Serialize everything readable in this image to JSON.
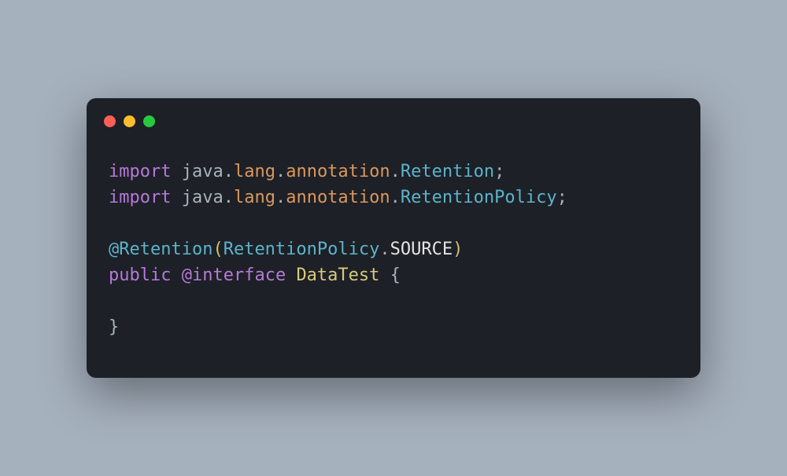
{
  "colors": {
    "background": "#a6b1be",
    "window": "#1d2026",
    "red": "#ff5f56",
    "yellow": "#ffbd2e",
    "green": "#27c93f",
    "keyword": "#b679d9",
    "namespace": "#a8b2bf",
    "package": "#d9985f",
    "type": "#5cb3cc",
    "classname": "#d9c97c",
    "paren": "#d3c173"
  },
  "code": {
    "lines": [
      [
        {
          "t": "import",
          "c": "keyword"
        },
        {
          "t": " ",
          "c": "white"
        },
        {
          "t": "java",
          "c": "namespace"
        },
        {
          "t": ".",
          "c": "op"
        },
        {
          "t": "lang",
          "c": "package"
        },
        {
          "t": ".",
          "c": "op"
        },
        {
          "t": "annotation",
          "c": "package"
        },
        {
          "t": ".",
          "c": "op"
        },
        {
          "t": "Retention",
          "c": "type"
        },
        {
          "t": ";",
          "c": "punct"
        }
      ],
      [
        {
          "t": "import",
          "c": "keyword"
        },
        {
          "t": " ",
          "c": "white"
        },
        {
          "t": "java",
          "c": "namespace"
        },
        {
          "t": ".",
          "c": "op"
        },
        {
          "t": "lang",
          "c": "package"
        },
        {
          "t": ".",
          "c": "op"
        },
        {
          "t": "annotation",
          "c": "package"
        },
        {
          "t": ".",
          "c": "op"
        },
        {
          "t": "RetentionPolicy",
          "c": "type"
        },
        {
          "t": ";",
          "c": "punct"
        }
      ],
      [],
      [
        {
          "t": "@Retention",
          "c": "annotation"
        },
        {
          "t": "(",
          "c": "paren"
        },
        {
          "t": "RetentionPolicy",
          "c": "type"
        },
        {
          "t": ".",
          "c": "op"
        },
        {
          "t": "SOURCE",
          "c": "white"
        },
        {
          "t": ")",
          "c": "paren"
        }
      ],
      [
        {
          "t": "public",
          "c": "modifier"
        },
        {
          "t": " ",
          "c": "white"
        },
        {
          "t": "@interface",
          "c": "modifier"
        },
        {
          "t": " ",
          "c": "white"
        },
        {
          "t": "DataTest",
          "c": "classname"
        },
        {
          "t": " ",
          "c": "white"
        },
        {
          "t": "{",
          "c": "brace"
        }
      ],
      [],
      [
        {
          "t": "}",
          "c": "brace"
        }
      ]
    ]
  }
}
